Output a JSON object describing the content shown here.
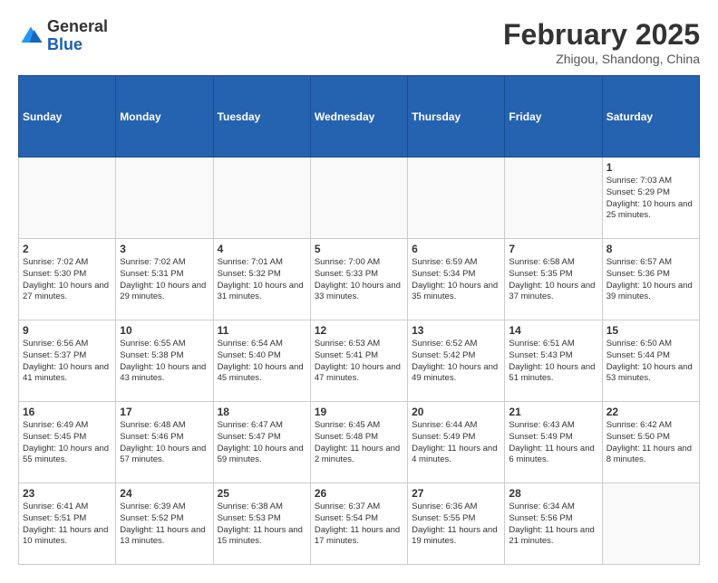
{
  "header": {
    "logo": {
      "line1": "General",
      "line2": "Blue"
    },
    "title": "February 2025",
    "subtitle": "Zhigou, Shandong, China"
  },
  "weekdays": [
    "Sunday",
    "Monday",
    "Tuesday",
    "Wednesday",
    "Thursday",
    "Friday",
    "Saturday"
  ],
  "weeks": [
    [
      {
        "day": null
      },
      {
        "day": null
      },
      {
        "day": null
      },
      {
        "day": null
      },
      {
        "day": null
      },
      {
        "day": null
      },
      {
        "day": 1,
        "sunrise": "Sunrise: 7:03 AM",
        "sunset": "Sunset: 5:29 PM",
        "daylight": "Daylight: 10 hours and 25 minutes."
      }
    ],
    [
      {
        "day": 2,
        "sunrise": "Sunrise: 7:02 AM",
        "sunset": "Sunset: 5:30 PM",
        "daylight": "Daylight: 10 hours and 27 minutes."
      },
      {
        "day": 3,
        "sunrise": "Sunrise: 7:02 AM",
        "sunset": "Sunset: 5:31 PM",
        "daylight": "Daylight: 10 hours and 29 minutes."
      },
      {
        "day": 4,
        "sunrise": "Sunrise: 7:01 AM",
        "sunset": "Sunset: 5:32 PM",
        "daylight": "Daylight: 10 hours and 31 minutes."
      },
      {
        "day": 5,
        "sunrise": "Sunrise: 7:00 AM",
        "sunset": "Sunset: 5:33 PM",
        "daylight": "Daylight: 10 hours and 33 minutes."
      },
      {
        "day": 6,
        "sunrise": "Sunrise: 6:59 AM",
        "sunset": "Sunset: 5:34 PM",
        "daylight": "Daylight: 10 hours and 35 minutes."
      },
      {
        "day": 7,
        "sunrise": "Sunrise: 6:58 AM",
        "sunset": "Sunset: 5:35 PM",
        "daylight": "Daylight: 10 hours and 37 minutes."
      },
      {
        "day": 8,
        "sunrise": "Sunrise: 6:57 AM",
        "sunset": "Sunset: 5:36 PM",
        "daylight": "Daylight: 10 hours and 39 minutes."
      }
    ],
    [
      {
        "day": 9,
        "sunrise": "Sunrise: 6:56 AM",
        "sunset": "Sunset: 5:37 PM",
        "daylight": "Daylight: 10 hours and 41 minutes."
      },
      {
        "day": 10,
        "sunrise": "Sunrise: 6:55 AM",
        "sunset": "Sunset: 5:38 PM",
        "daylight": "Daylight: 10 hours and 43 minutes."
      },
      {
        "day": 11,
        "sunrise": "Sunrise: 6:54 AM",
        "sunset": "Sunset: 5:40 PM",
        "daylight": "Daylight: 10 hours and 45 minutes."
      },
      {
        "day": 12,
        "sunrise": "Sunrise: 6:53 AM",
        "sunset": "Sunset: 5:41 PM",
        "daylight": "Daylight: 10 hours and 47 minutes."
      },
      {
        "day": 13,
        "sunrise": "Sunrise: 6:52 AM",
        "sunset": "Sunset: 5:42 PM",
        "daylight": "Daylight: 10 hours and 49 minutes."
      },
      {
        "day": 14,
        "sunrise": "Sunrise: 6:51 AM",
        "sunset": "Sunset: 5:43 PM",
        "daylight": "Daylight: 10 hours and 51 minutes."
      },
      {
        "day": 15,
        "sunrise": "Sunrise: 6:50 AM",
        "sunset": "Sunset: 5:44 PM",
        "daylight": "Daylight: 10 hours and 53 minutes."
      }
    ],
    [
      {
        "day": 16,
        "sunrise": "Sunrise: 6:49 AM",
        "sunset": "Sunset: 5:45 PM",
        "daylight": "Daylight: 10 hours and 55 minutes."
      },
      {
        "day": 17,
        "sunrise": "Sunrise: 6:48 AM",
        "sunset": "Sunset: 5:46 PM",
        "daylight": "Daylight: 10 hours and 57 minutes."
      },
      {
        "day": 18,
        "sunrise": "Sunrise: 6:47 AM",
        "sunset": "Sunset: 5:47 PM",
        "daylight": "Daylight: 10 hours and 59 minutes."
      },
      {
        "day": 19,
        "sunrise": "Sunrise: 6:45 AM",
        "sunset": "Sunset: 5:48 PM",
        "daylight": "Daylight: 11 hours and 2 minutes."
      },
      {
        "day": 20,
        "sunrise": "Sunrise: 6:44 AM",
        "sunset": "Sunset: 5:49 PM",
        "daylight": "Daylight: 11 hours and 4 minutes."
      },
      {
        "day": 21,
        "sunrise": "Sunrise: 6:43 AM",
        "sunset": "Sunset: 5:49 PM",
        "daylight": "Daylight: 11 hours and 6 minutes."
      },
      {
        "day": 22,
        "sunrise": "Sunrise: 6:42 AM",
        "sunset": "Sunset: 5:50 PM",
        "daylight": "Daylight: 11 hours and 8 minutes."
      }
    ],
    [
      {
        "day": 23,
        "sunrise": "Sunrise: 6:41 AM",
        "sunset": "Sunset: 5:51 PM",
        "daylight": "Daylight: 11 hours and 10 minutes."
      },
      {
        "day": 24,
        "sunrise": "Sunrise: 6:39 AM",
        "sunset": "Sunset: 5:52 PM",
        "daylight": "Daylight: 11 hours and 13 minutes."
      },
      {
        "day": 25,
        "sunrise": "Sunrise: 6:38 AM",
        "sunset": "Sunset: 5:53 PM",
        "daylight": "Daylight: 11 hours and 15 minutes."
      },
      {
        "day": 26,
        "sunrise": "Sunrise: 6:37 AM",
        "sunset": "Sunset: 5:54 PM",
        "daylight": "Daylight: 11 hours and 17 minutes."
      },
      {
        "day": 27,
        "sunrise": "Sunrise: 6:36 AM",
        "sunset": "Sunset: 5:55 PM",
        "daylight": "Daylight: 11 hours and 19 minutes."
      },
      {
        "day": 28,
        "sunrise": "Sunrise: 6:34 AM",
        "sunset": "Sunset: 5:56 PM",
        "daylight": "Daylight: 11 hours and 21 minutes."
      },
      {
        "day": null
      }
    ]
  ]
}
